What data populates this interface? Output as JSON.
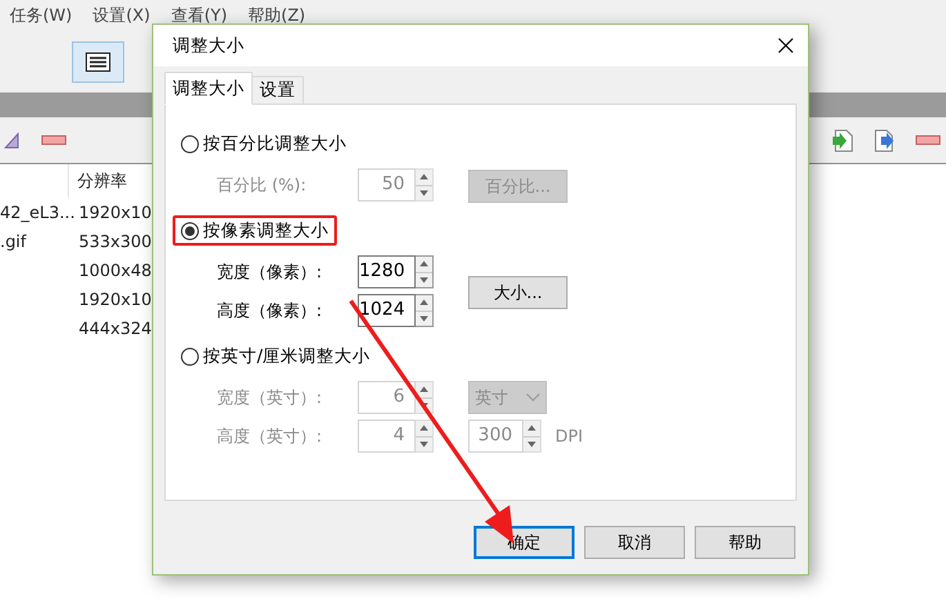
{
  "menu": [
    "任务(W)",
    "设置(X)",
    "查看(Y)",
    "帮助(Z)"
  ],
  "file_list": {
    "columns": [
      "分辨率"
    ],
    "rows": [
      {
        "name": "42_eL3...",
        "resolution": "1920x10"
      },
      {
        "name": ".gif",
        "resolution": "533x300"
      },
      {
        "resolution": "1000x48"
      },
      {
        "resolution": "1920x10"
      },
      {
        "resolution": "444x324"
      }
    ]
  },
  "dialog": {
    "title": "调整大小",
    "tabs": [
      {
        "label": "调整大小",
        "selected": true
      },
      {
        "label": "设置",
        "selected": false
      }
    ],
    "options": [
      {
        "label": "按百分比调整大小",
        "selected": false,
        "highlighted": false,
        "rows": [
          {
            "label": "百分比 (%):",
            "value": "50",
            "extra": {
              "kind": "button",
              "label": "百分比..."
            }
          }
        ]
      },
      {
        "label": "按像素调整大小",
        "selected": true,
        "highlighted": true,
        "side_button": "大小...",
        "rows": [
          {
            "label": "宽度（像素）:",
            "value": "1280"
          },
          {
            "label": "高度（像素）:",
            "value": "1024"
          }
        ]
      },
      {
        "label": "按英寸/厘米调整大小",
        "selected": false,
        "highlighted": false,
        "rows": [
          {
            "label": "宽度（英寸）:",
            "value": "6",
            "extra": {
              "kind": "select",
              "value": "英寸"
            }
          },
          {
            "label": "高度（英寸）:",
            "value": "4",
            "extra": {
              "kind": "spin",
              "value": "300",
              "suffix": "DPI"
            }
          }
        ]
      }
    ],
    "buttons": [
      {
        "label": "确定",
        "default": true
      },
      {
        "label": "取消",
        "default": false
      },
      {
        "label": "帮助",
        "default": false
      }
    ]
  }
}
